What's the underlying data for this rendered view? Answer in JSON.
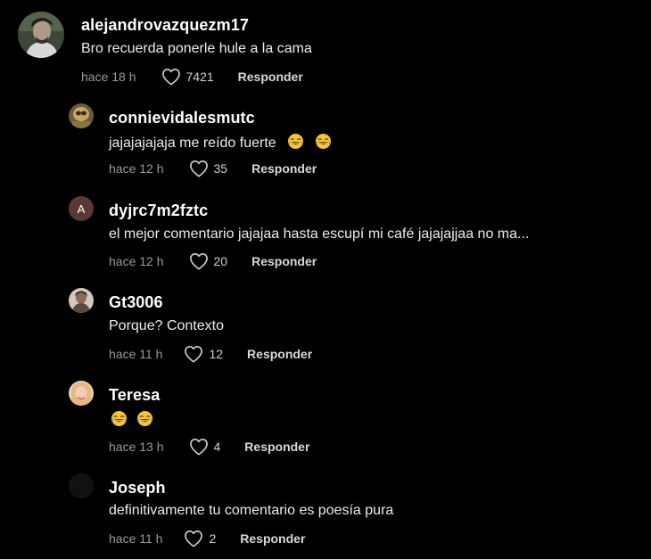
{
  "colors": {
    "background": "#000000",
    "username": "#ffffff",
    "text": "#ececec",
    "meta": "#9a9a9a",
    "reply": "#d8d8d8"
  },
  "comments": [
    {
      "username": "alejandrovazquezm17",
      "text": "Bro recuerda ponerle hule a la cama",
      "time": "hace 18 h",
      "likes": "7421",
      "reply_label": "Responder",
      "avatar": "profile-photo-icon"
    },
    {
      "username": "connievidalesmutc",
      "text": "jajajajajaja me reído fuerte",
      "emojis": [
        "face-with-tears-of-joy-icon",
        "face-with-tears-of-joy-icon"
      ],
      "time": "hace 12 h",
      "likes": "35",
      "reply_label": "Responder",
      "avatar": "profile-photo-icon"
    },
    {
      "username": "dyjrc7m2fztc",
      "text": "el mejor comentario jajajaa hasta escupí mi café jajajajjaa no ma...",
      "time": "hace 12 h",
      "likes": "20",
      "reply_label": "Responder",
      "avatar_letter": "A"
    },
    {
      "username": "Gt3006",
      "text": "Porque? Contexto",
      "time": "hace 11 h",
      "likes": "12",
      "reply_label": "Responder",
      "avatar": "profile-photo-icon"
    },
    {
      "username": "Teresa",
      "text": "",
      "emojis": [
        "face-with-tears-of-joy-icon",
        "face-with-tears-of-joy-icon"
      ],
      "time": "hace 13 h",
      "likes": "4",
      "reply_label": "Responder",
      "avatar": "profile-photo-icon"
    },
    {
      "username": "Joseph",
      "text": "definitivamente tu comentario es poesía pura",
      "time": "hace 11 h",
      "likes": "2",
      "reply_label": "Responder",
      "avatar": "profile-photo-icon"
    }
  ]
}
